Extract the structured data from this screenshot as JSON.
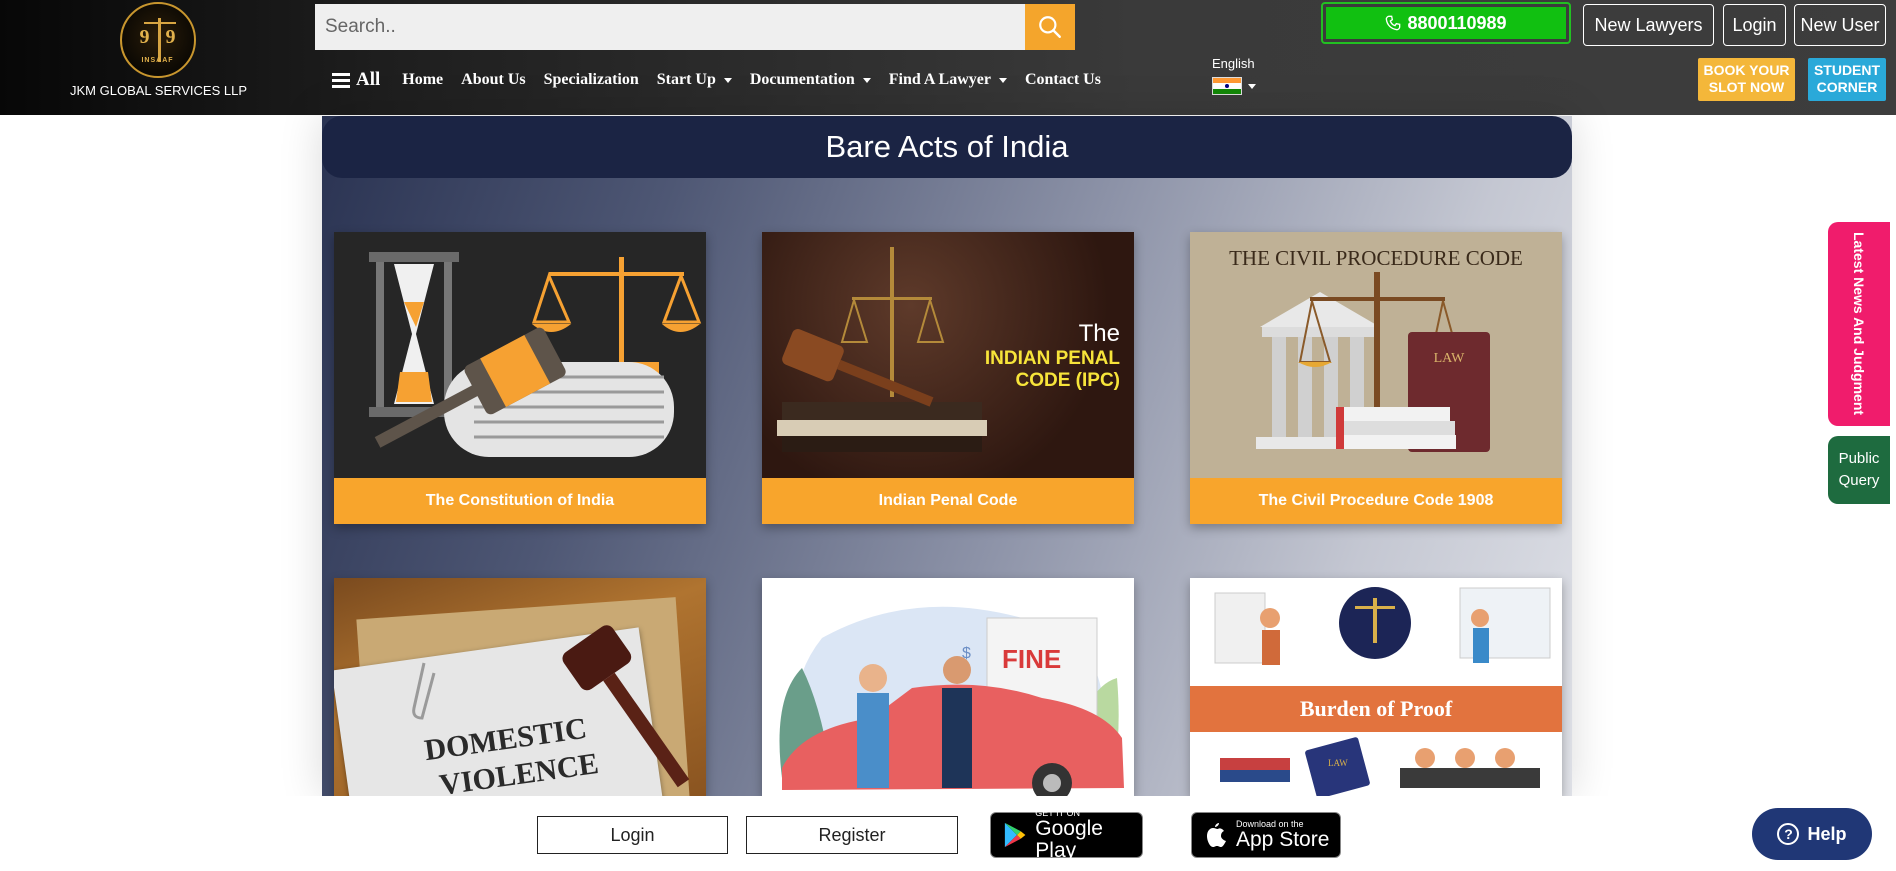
{
  "brand": {
    "name": "JKM GLOBAL SERVICES LLP",
    "emblem_left": "9",
    "emblem_right": "9",
    "emblem_text": "INSAAF"
  },
  "search": {
    "placeholder": "Search..",
    "icon": "search-icon"
  },
  "header_actions": {
    "phone": "8800110989",
    "new_lawyers": "New Lawyers",
    "login": "Login",
    "new_user": "New User",
    "book_slot_line1": "BOOK YOUR",
    "book_slot_line2": "SLOT NOW",
    "student_line1": "STUDENT",
    "student_line2": "CORNER"
  },
  "nav": {
    "all": "All",
    "items": [
      "Home",
      "About Us",
      "Specialization",
      "Start Up",
      "Documentation",
      "Find A Lawyer",
      "Contact Us"
    ]
  },
  "language": {
    "label": "English"
  },
  "page": {
    "title": "Bare Acts of India"
  },
  "cards": [
    {
      "label": "The Constitution of India"
    },
    {
      "label": "Indian Penal Code",
      "img_text_1": "The",
      "img_text_2": "INDIAN PENAL",
      "img_text_3": "CODE (IPC)"
    },
    {
      "label": "The Civil Procedure Code 1908",
      "img_text_1": "THE CIVIL PROCEDURE CODE",
      "img_text_2": "LAW"
    },
    {
      "img_text_1": "DOMESTIC",
      "img_text_2": "VIOLENCE"
    },
    {
      "img_text_1": "FINE",
      "img_text_2": "$"
    },
    {
      "img_text_1": "Burden of Proof",
      "img_text_2": "LAW"
    }
  ],
  "side_tabs": {
    "news": "Latest News And Judgment",
    "query_1": "Public",
    "query_2": "Query"
  },
  "footer": {
    "login": "Login",
    "register": "Register",
    "google_small": "GET IT ON",
    "google_big": "Google Play",
    "apple_small": "Download on the",
    "apple_big": "App Store"
  },
  "help": {
    "label": "Help"
  },
  "colors": {
    "accent_orange": "#f8a52c",
    "header_navy": "#1b2444",
    "phone_green": "#11c011",
    "news_pink": "#f01c6c"
  }
}
